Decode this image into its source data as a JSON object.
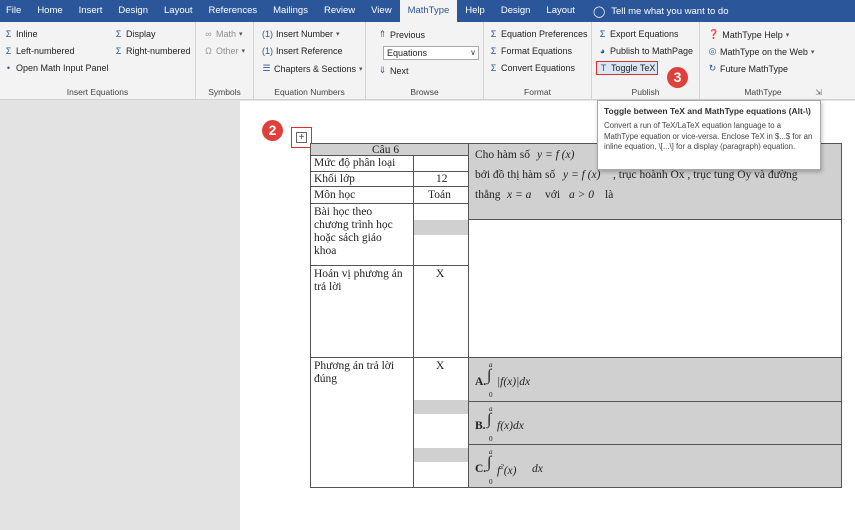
{
  "tabs": [
    "File",
    "Home",
    "Insert",
    "Design",
    "Layout",
    "References",
    "Mailings",
    "Review",
    "View",
    "MathType",
    "Help",
    "Design",
    "Layout"
  ],
  "active_tab": "MathType",
  "tell_me": "Tell me what you want to do",
  "groups": {
    "insert_equations": {
      "label": "Insert Equations",
      "inline": "Inline",
      "display": "Display",
      "left_numbered": "Left-numbered",
      "right_numbered": "Right-numbered",
      "open_panel": "Open Math Input Panel"
    },
    "symbols": {
      "label": "Symbols",
      "math": "Math",
      "other": "Other"
    },
    "equation_numbers": {
      "label": "Equation Numbers",
      "insert_number": "Insert Number",
      "insert_reference": "Insert Reference",
      "chapters": "Chapters & Sections"
    },
    "browse": {
      "label": "Browse",
      "previous": "Previous",
      "combo_value": "Equations",
      "next": "Next"
    },
    "format": {
      "label": "Format",
      "preferences": "Equation Preferences",
      "format_equations": "Format Equations",
      "convert": "Convert Equations"
    },
    "publish": {
      "label": "Publish",
      "export": "Export Equations",
      "publish_mathpage": "Publish to MathPage",
      "toggle_tex": "Toggle TeX"
    },
    "mathtype": {
      "label": "MathType",
      "help": "MathType Help",
      "on_web": "MathType on the Web",
      "future": "Future MathType"
    }
  },
  "badges": {
    "b2": "2",
    "b3": "3"
  },
  "tooltip": {
    "title": "Toggle between TeX and MathType equations (Alt-\\)",
    "body": "Convert a run of TeX/LaTeX equation language to a MathType equation or vice-versa. Enclose TeX in $...$ for an inline equation, \\[...\\] for a display (paragraph) equation."
  },
  "table": {
    "header": "Câu 6",
    "rows": [
      {
        "label": "Mức độ phân loại",
        "value": ""
      },
      {
        "label": "Khối lớp",
        "value": "12"
      },
      {
        "label": "Môn học",
        "value": "Toán"
      },
      {
        "label": "Bài học theo chương trình học hoặc sách giáo khoa",
        "value": ""
      },
      {
        "label": "Hoán vị phương án trả lời",
        "value": "X"
      },
      {
        "label": "Phương án trả lời đúng",
        "value": "X"
      }
    ],
    "question": {
      "line1": "Cho hàm số",
      "line2": "bởi đồ thị hàm số",
      "line2_tail": ", trục hoành Ox , trục tung Oy  và đường",
      "line3": "thẳng",
      "line3_mid": "với",
      "line3_tail": "là"
    },
    "answers": [
      {
        "letter": "A.",
        "expr": "|f(x)|dx"
      },
      {
        "letter": "B.",
        "expr": "f(x)dx"
      },
      {
        "letter": "C.",
        "expr": "dx"
      }
    ]
  }
}
